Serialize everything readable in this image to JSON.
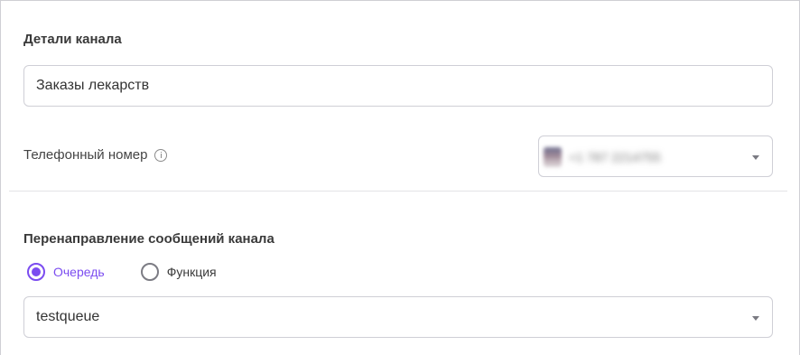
{
  "channel_details": {
    "title": "Детали канала",
    "name_value": "Заказы лекарств"
  },
  "phone": {
    "label": "Телефонный номер",
    "info_icon": "info-icon",
    "flag_icon": "flag-icon",
    "value": "+1 787 2214755"
  },
  "redirect": {
    "title": "Перенаправление сообщений канала",
    "options": [
      {
        "label": "Очередь",
        "checked": true
      },
      {
        "label": "Функция",
        "checked": false
      }
    ],
    "selected_value": "testqueue",
    "dropdown_icon": "chevron-down-icon"
  },
  "colors": {
    "accent": "#7b4cf0",
    "border": "#cfcfd6"
  }
}
